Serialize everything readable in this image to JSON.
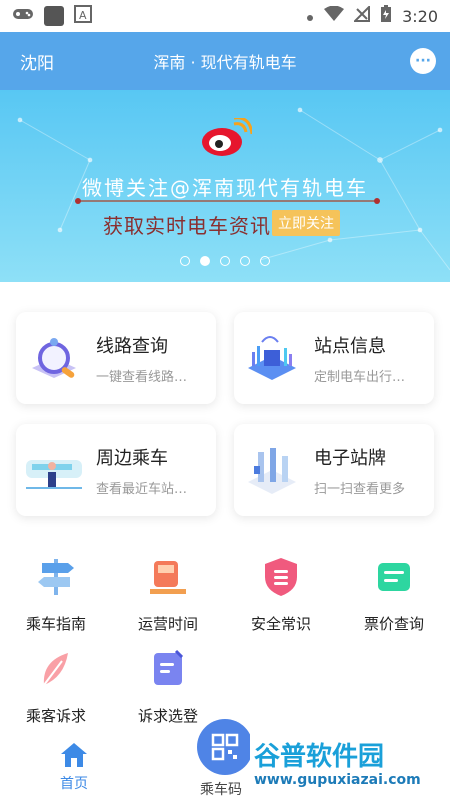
{
  "status_bar": {
    "time": "3:20"
  },
  "header": {
    "city": "沈阳",
    "title": "浑南 · 现代有轨电车"
  },
  "banner": {
    "line1": "微博关注@浑南现代有轨电车",
    "line2": "获取实时电车资讯",
    "button": "立即关注"
  },
  "cards": [
    {
      "title": "线路查询",
      "subtitle": "一键查看线路…"
    },
    {
      "title": "站点信息",
      "subtitle": "定制电车出行…"
    },
    {
      "title": "周边乘车",
      "subtitle": "查看最近车站…"
    },
    {
      "title": "电子站牌",
      "subtitle": "扫一扫查看更多"
    }
  ],
  "grid": [
    {
      "label": "乘车指南"
    },
    {
      "label": "运营时间"
    },
    {
      "label": "安全常识"
    },
    {
      "label": "票价查询"
    },
    {
      "label": "乘客诉求"
    },
    {
      "label": "诉求选登"
    }
  ],
  "tabbar": {
    "home": "首页",
    "qr": "乘车码"
  },
  "watermark": {
    "text": "谷普软件园",
    "url": "www.gupuxiazai.com"
  },
  "colors": {
    "accent": "#56a6ea",
    "tab_active": "#3d8ae6"
  }
}
